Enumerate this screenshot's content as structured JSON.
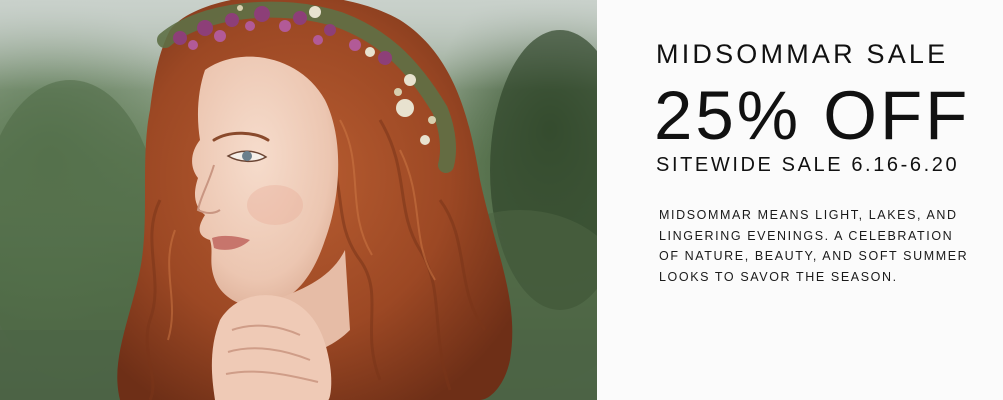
{
  "banner": {
    "photo_alt": "Woman with red wavy hair wearing a dried flower crown",
    "eyebrow": "MIDSOMMAR SALE",
    "headline": "25% OFF",
    "dates": "SITEWIDE SALE 6.16-6.20",
    "body": "MIDSOMMAR MEANS LIGHT, LAKES, AND LINGERING EVENINGS. A CELEBRATION OF NATURE, BEAUTY, AND SOFT SUMMER LOOKS TO SAVOR THE SEASON."
  },
  "colors": {
    "text": "#111111",
    "panel_background": "#fbfbfb",
    "hair": "#a9532c",
    "skin": "#efcdbb",
    "foliage": "#58734f"
  }
}
